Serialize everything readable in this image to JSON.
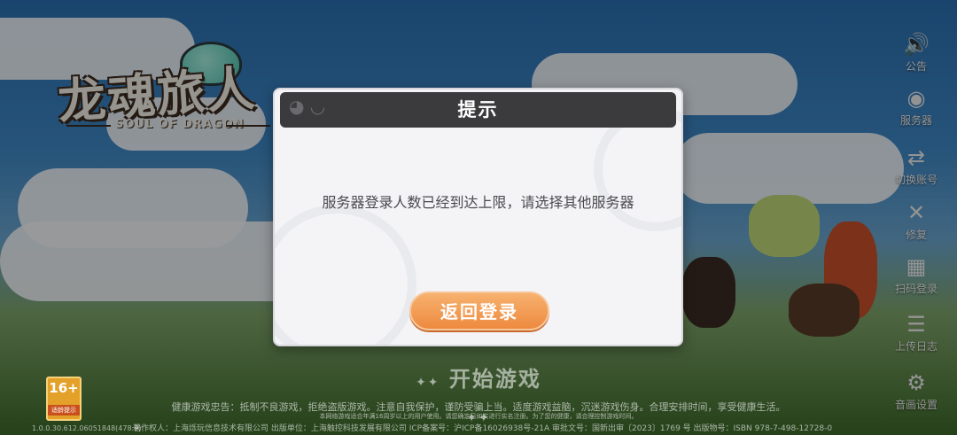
{
  "logo": {
    "title": "龙魂旅人",
    "subtitle": "SOUL OF DRAGON"
  },
  "side_menu": [
    {
      "icon": "speaker-icon",
      "glyph": "🔊",
      "label": "公告"
    },
    {
      "icon": "globe-icon",
      "glyph": "◉",
      "label": "服务器"
    },
    {
      "icon": "switch-account-icon",
      "glyph": "⇄",
      "label": "切换账号"
    },
    {
      "icon": "tools-icon",
      "glyph": "✕",
      "label": "修复"
    },
    {
      "icon": "scan-login-icon",
      "glyph": "▦",
      "label": "扫码登录"
    },
    {
      "icon": "log-icon",
      "glyph": "☰",
      "label": "上传日志"
    },
    {
      "icon": "gear-icon",
      "glyph": "⚙",
      "label": "音画设置"
    }
  ],
  "start_button": {
    "label": "开始游戏",
    "decoration": "✦✦"
  },
  "age_rating": {
    "value": "16+",
    "label": "适龄提示"
  },
  "footer": {
    "line1": "健康游戏忠告：抵制不良游戏，拒绝盗版游戏。注意自我保护，谨防受骗上当。适度游戏益脑，沉迷游戏伤身。合理安排时间，享受健康生活。",
    "line2": "本网络游戏适合年满16周岁以上的用户使用。请您确定已如实进行实名注册。为了您的健康，请合理控制游戏时间。",
    "line3": "著作权人：上海烁玩信息技术有限公司 出版单位：上海触控科技发展有限公司 ICP备案号：沪ICP备16026938号-21A 审批文号：国新出审〔2023〕1769 号 出版物号：ISBN 978-7-498-12728-0"
  },
  "version": "1.0.0.30.612.06051848(478:9)",
  "dialog": {
    "title": "提示",
    "message": "服务器登录人数已经到达上限，请选择其他服务器",
    "button_label": "返回登录"
  },
  "colors": {
    "dialog_header": "#3b3b3d",
    "button": "#ee8a3f",
    "dialog_bg": "#f4f4f6"
  }
}
